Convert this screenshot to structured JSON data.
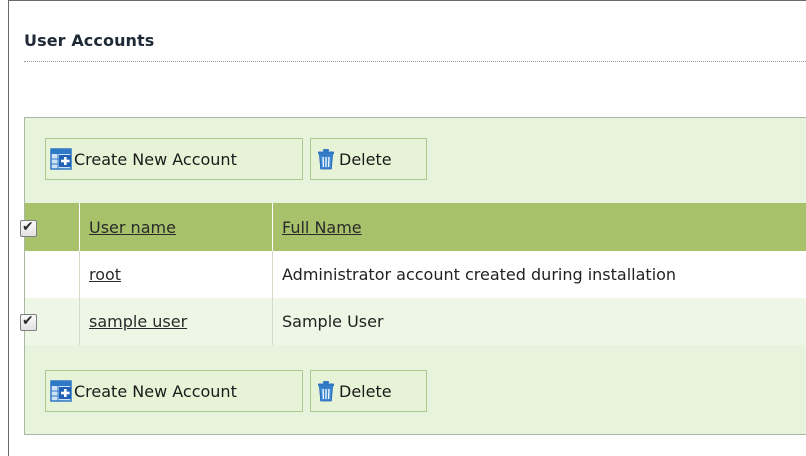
{
  "page": {
    "title": "User Accounts"
  },
  "toolbar_top": {
    "create_label": "Create New Account",
    "delete_label": "Delete"
  },
  "toolbar_bottom": {
    "create_label": "Create New Account",
    "delete_label": "Delete"
  },
  "table": {
    "headers": {
      "select_all_checked": true,
      "user_name": "User name",
      "full_name": "Full Name"
    },
    "rows": [
      {
        "user_name": "root",
        "full_name": "Administrator account created during installation",
        "checked": false,
        "selectable": false
      },
      {
        "user_name": "sample user",
        "full_name": "Sample User",
        "checked": true,
        "selectable": true
      }
    ]
  },
  "colors": {
    "panel_bg": "#e8f3dd",
    "header_bg": "#a7c26a",
    "button_bg": "#e6f3d6",
    "icon_blue": "#2f78c6"
  },
  "icons": {
    "create": "add-table-icon",
    "delete": "trash-icon"
  }
}
